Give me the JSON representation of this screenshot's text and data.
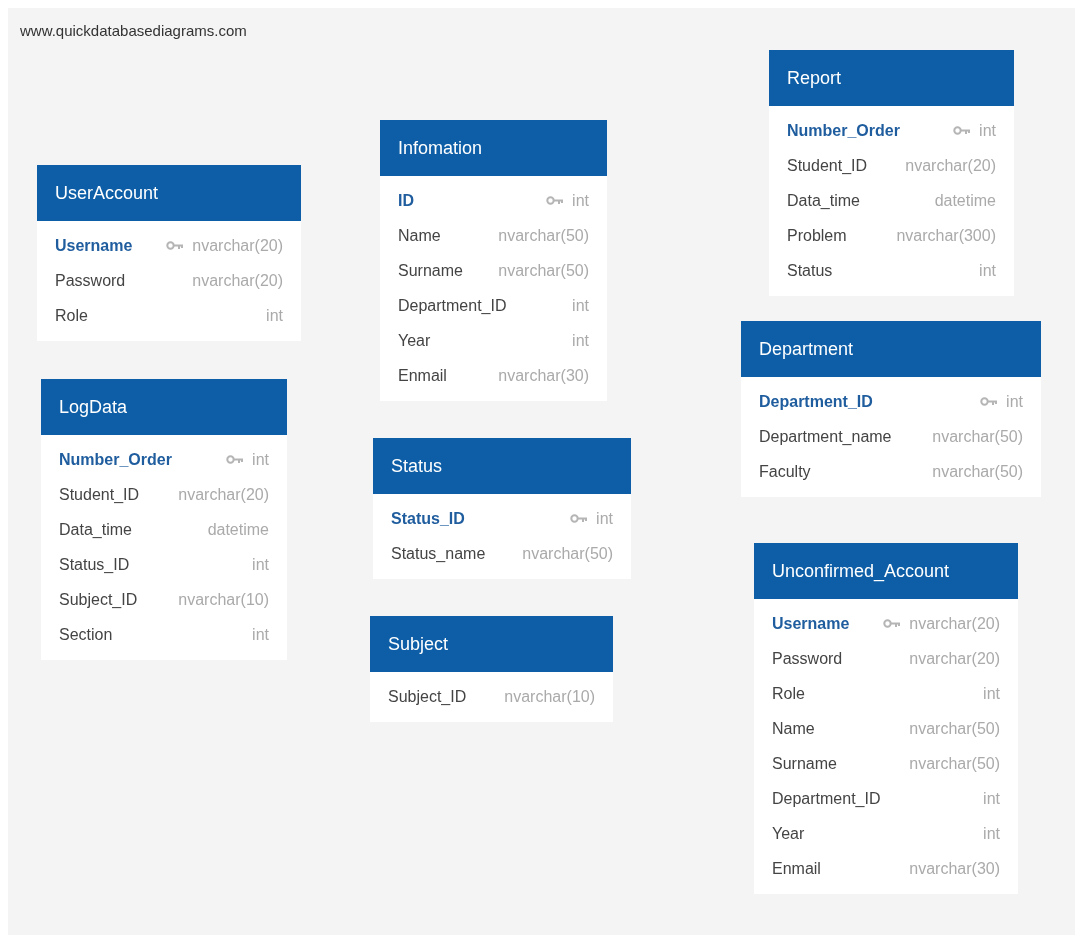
{
  "site_label": "www.quickdatabasediagrams.com",
  "tables": [
    {
      "name": "UserAccount",
      "columns": [
        {
          "name": "Username",
          "type": "nvarchar(20)",
          "primary_key": true
        },
        {
          "name": "Password",
          "type": "nvarchar(20)",
          "primary_key": false
        },
        {
          "name": "Role",
          "type": "int",
          "primary_key": false
        }
      ]
    },
    {
      "name": "Infomation",
      "columns": [
        {
          "name": "ID",
          "type": "int",
          "primary_key": true
        },
        {
          "name": "Name",
          "type": "nvarchar(50)",
          "primary_key": false
        },
        {
          "name": "Surname",
          "type": "nvarchar(50)",
          "primary_key": false
        },
        {
          "name": "Department_ID",
          "type": "int",
          "primary_key": false
        },
        {
          "name": "Year",
          "type": "int",
          "primary_key": false
        },
        {
          "name": "Enmail",
          "type": "nvarchar(30)",
          "primary_key": false
        }
      ]
    },
    {
      "name": "Report",
      "columns": [
        {
          "name": "Number_Order",
          "type": "int",
          "primary_key": true
        },
        {
          "name": "Student_ID",
          "type": "nvarchar(20)",
          "primary_key": false
        },
        {
          "name": "Data_time",
          "type": "datetime",
          "primary_key": false
        },
        {
          "name": "Problem",
          "type": "nvarchar(300)",
          "primary_key": false
        },
        {
          "name": "Status",
          "type": "int",
          "primary_key": false
        }
      ]
    },
    {
      "name": "LogData",
      "columns": [
        {
          "name": "Number_Order",
          "type": "int",
          "primary_key": true
        },
        {
          "name": "Student_ID",
          "type": "nvarchar(20)",
          "primary_key": false
        },
        {
          "name": "Data_time",
          "type": "datetime",
          "primary_key": false
        },
        {
          "name": "Status_ID",
          "type": "int",
          "primary_key": false
        },
        {
          "name": "Subject_ID",
          "type": "nvarchar(10)",
          "primary_key": false
        },
        {
          "name": "Section",
          "type": "int",
          "primary_key": false
        }
      ]
    },
    {
      "name": "Status",
      "columns": [
        {
          "name": "Status_ID",
          "type": "int",
          "primary_key": true
        },
        {
          "name": "Status_name",
          "type": "nvarchar(50)",
          "primary_key": false
        }
      ]
    },
    {
      "name": "Department",
      "columns": [
        {
          "name": "Department_ID",
          "type": "int",
          "primary_key": true
        },
        {
          "name": "Department_name",
          "type": "nvarchar(50)",
          "primary_key": false
        },
        {
          "name": "Faculty",
          "type": "nvarchar(50)",
          "primary_key": false
        }
      ]
    },
    {
      "name": "Subject",
      "columns": [
        {
          "name": "Subject_ID",
          "type": "nvarchar(10)",
          "primary_key": false
        }
      ]
    },
    {
      "name": "Unconfirmed_Account",
      "columns": [
        {
          "name": "Username",
          "type": "nvarchar(20)",
          "primary_key": true
        },
        {
          "name": "Password",
          "type": "nvarchar(20)",
          "primary_key": false
        },
        {
          "name": "Role",
          "type": "int",
          "primary_key": false
        },
        {
          "name": "Name",
          "type": "nvarchar(50)",
          "primary_key": false
        },
        {
          "name": "Surname",
          "type": "nvarchar(50)",
          "primary_key": false
        },
        {
          "name": "Department_ID",
          "type": "int",
          "primary_key": false
        },
        {
          "name": "Year",
          "type": "int",
          "primary_key": false
        },
        {
          "name": "Enmail",
          "type": "nvarchar(30)",
          "primary_key": false
        }
      ]
    }
  ]
}
